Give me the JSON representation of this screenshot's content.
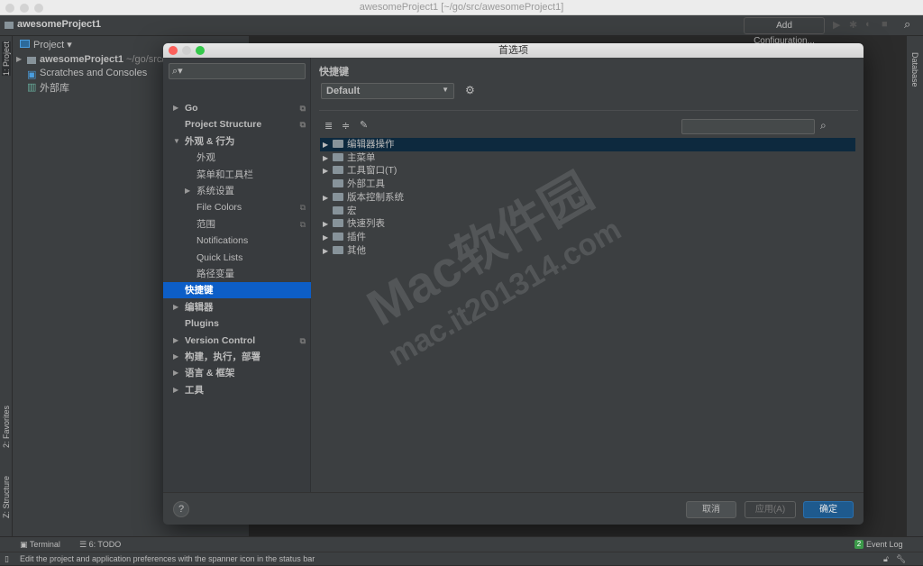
{
  "window": {
    "title": "awesomeProject1 [~/go/src/awesomeProject1]"
  },
  "toolbar": {
    "project_name": "awesomeProject1",
    "add_configuration": "Add Configuration..."
  },
  "left_tabs": [
    "1: Project",
    "2: Favorites",
    "Z: Structure"
  ],
  "right_tabs": [
    "Database"
  ],
  "project_panel": {
    "selector": "Project",
    "items": [
      {
        "label": "awesomeProject1",
        "path": "~/go/src/"
      },
      {
        "label": "Scratches and Consoles"
      },
      {
        "label": "外部库"
      }
    ]
  },
  "dialog": {
    "title": "首选项",
    "search_placeholder": "",
    "sidebar": [
      {
        "label": "Go",
        "arrow": "▶",
        "bold": true,
        "copy": true
      },
      {
        "label": "Project Structure",
        "bold": true,
        "copy": true
      },
      {
        "label": "外观 & 行为",
        "arrow": "▼",
        "bold": true
      },
      {
        "label": "外观",
        "indent": 1
      },
      {
        "label": "菜单和工具栏",
        "indent": 1
      },
      {
        "label": "系统设置",
        "arrow": "▶",
        "indent": 1
      },
      {
        "label": "File Colors",
        "indent": 1,
        "copy": true
      },
      {
        "label": "范围",
        "indent": 1,
        "copy": true
      },
      {
        "label": "Notifications",
        "indent": 1
      },
      {
        "label": "Quick Lists",
        "indent": 1
      },
      {
        "label": "路径变量",
        "indent": 1
      },
      {
        "label": "快捷键",
        "bold": true,
        "selected": true
      },
      {
        "label": "编辑器",
        "arrow": "▶",
        "bold": true
      },
      {
        "label": "Plugins",
        "bold": true
      },
      {
        "label": "Version Control",
        "arrow": "▶",
        "bold": true,
        "copy": true
      },
      {
        "label": "构建，执行，部署",
        "arrow": "▶",
        "bold": true
      },
      {
        "label": "语言 & 框架",
        "arrow": "▶",
        "bold": true
      },
      {
        "label": "工具",
        "arrow": "▶",
        "bold": true
      }
    ],
    "main": {
      "heading": "快捷键",
      "keymap": "Default",
      "search_value": "",
      "tree": [
        {
          "label": "编辑器操作",
          "arrow": true,
          "selected": true
        },
        {
          "label": "主菜单",
          "arrow": true
        },
        {
          "label": "工具窗口(T)",
          "arrow": true
        },
        {
          "label": "外部工具",
          "arrow": false
        },
        {
          "label": "版本控制系统",
          "arrow": true
        },
        {
          "label": "宏",
          "arrow": false
        },
        {
          "label": "快速列表",
          "arrow": true
        },
        {
          "label": "插件",
          "arrow": true
        },
        {
          "label": "其他",
          "arrow": true
        }
      ]
    },
    "footer": {
      "help": "?",
      "cancel": "取消",
      "apply": "应用(A)",
      "ok": "确定"
    }
  },
  "bottom_bar": {
    "terminal": "Terminal",
    "todo": "6: TODO",
    "event_log": "Event Log",
    "event_count": "2"
  },
  "status_bar": {
    "message": "Edit the project and application preferences with the spanner icon in the status bar"
  },
  "watermark": {
    "line1": "Mac软件园",
    "line2": "mac.it201314.com"
  },
  "colors": {
    "selection": "#0d5ec7",
    "ok_button": "#1e5a8e",
    "tree_selection": "#0d293e"
  }
}
